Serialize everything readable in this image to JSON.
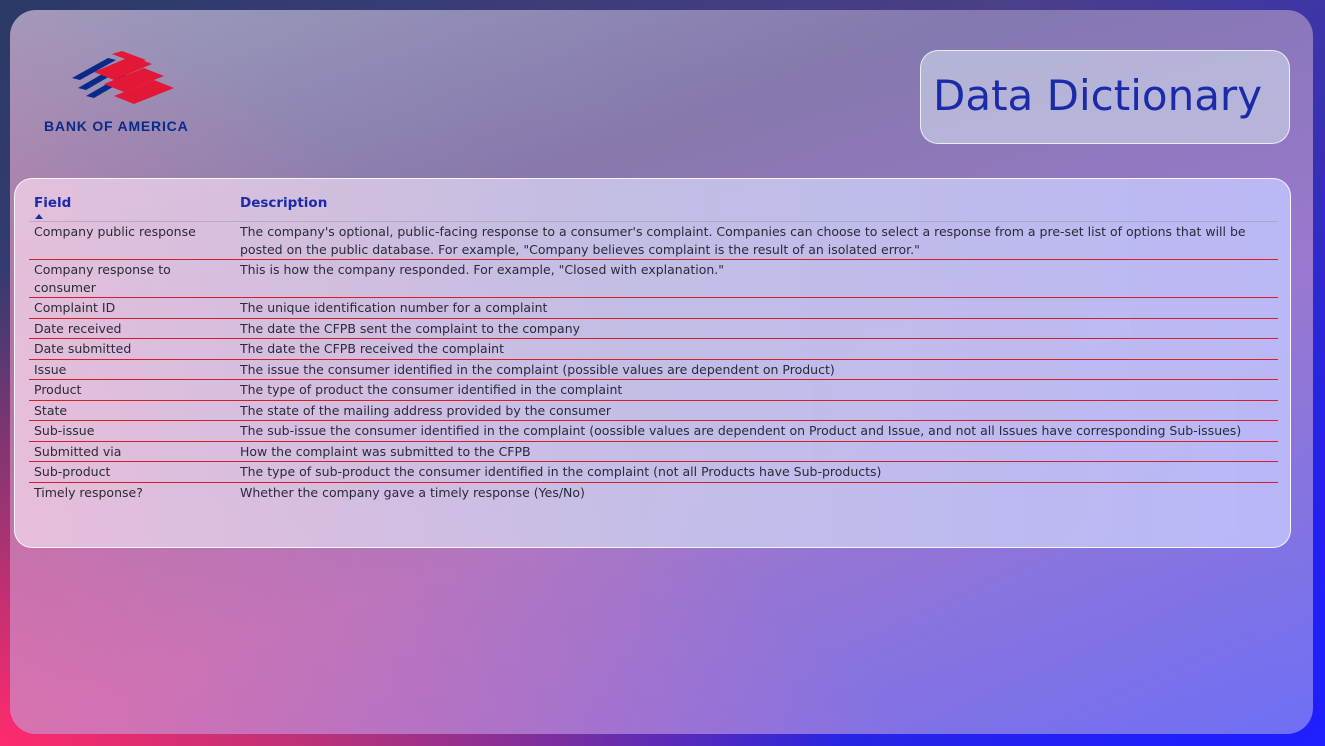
{
  "brand": {
    "name": "BANK OF AMERICA",
    "logo_icon": "bank-of-america-flag-icon",
    "colors": {
      "red": "#e31837",
      "navy": "#0a2a8a"
    }
  },
  "page": {
    "title": "Data Dictionary",
    "accent": "#1a2aa8"
  },
  "table": {
    "columns": [
      "Field",
      "Description"
    ],
    "sort": {
      "column": "Field",
      "direction": "ascending"
    },
    "rows": [
      {
        "field": "Company public response",
        "description": "The company's optional, public-facing response to a consumer's complaint. Companies can choose to select a response from a pre-set list of options that will be posted on the public database. For example, \"Company believes complaint is the result of an isolated error.\""
      },
      {
        "field": "Company response to consumer",
        "description": "This is how the company responded. For example, \"Closed with explanation.\""
      },
      {
        "field": "Complaint ID",
        "description": "The unique identification number for a complaint"
      },
      {
        "field": "Date received",
        "description": "The date the CFPB sent the complaint to the company"
      },
      {
        "field": "Date submitted",
        "description": "The date the CFPB received the complaint"
      },
      {
        "field": "Issue",
        "description": "The issue the consumer identified in the complaint (possible values are dependent on Product)"
      },
      {
        "field": "Product",
        "description": "The type of product the consumer identified in the complaint"
      },
      {
        "field": "State",
        "description": "The state of the mailing address provided by the consumer"
      },
      {
        "field": "Sub-issue",
        "description": "The sub-issue the consumer identified in the complaint (oossible values are dependent on Product and Issue, and not all Issues have corresponding Sub-issues)"
      },
      {
        "field": "Submitted via",
        "description": "How the complaint was submitted to the CFPB"
      },
      {
        "field": "Sub-product",
        "description": "The type of sub-product the consumer identified in the complaint (not all Products have Sub-products)"
      },
      {
        "field": "Timely response?",
        "description": "Whether the company gave a timely response (Yes/No)"
      }
    ]
  }
}
